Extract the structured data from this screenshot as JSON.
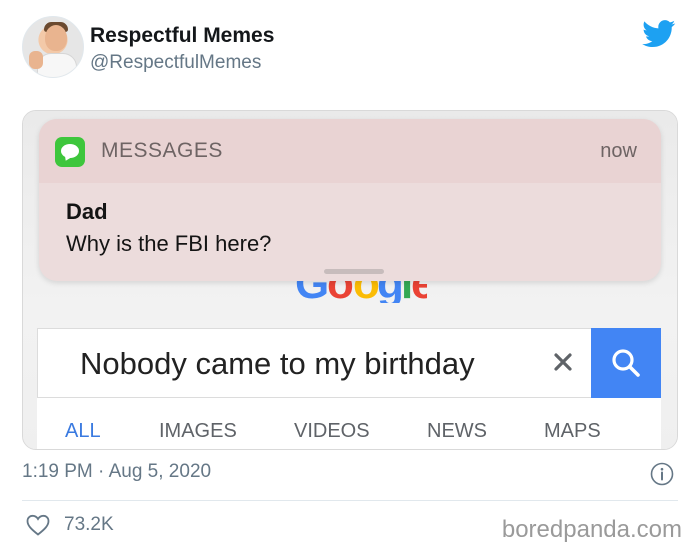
{
  "tweet": {
    "display_name": "Respectful Memes",
    "handle": "@RespectfulMemes",
    "timestamp": "1:19 PM · Aug 5, 2020",
    "likes": "73.2K"
  },
  "notification": {
    "app_name": "MESSAGES",
    "time": "now",
    "sender": "Dad",
    "message": "Why is the FBI here?"
  },
  "search": {
    "query": "Nobody came to my birthday",
    "tabs": [
      {
        "label": "ALL",
        "active": true
      },
      {
        "label": "IMAGES",
        "active": false
      },
      {
        "label": "VIDEOS",
        "active": false
      },
      {
        "label": "NEWS",
        "active": false
      },
      {
        "label": "MAPS",
        "active": false
      }
    ]
  },
  "watermark": "boredpanda.com",
  "icons": {
    "twitter": "twitter-bird-icon",
    "messages": "messages-icon",
    "clear": "close-icon",
    "search": "search-icon",
    "info": "info-icon",
    "like": "heart-icon"
  },
  "colors": {
    "twitter_blue": "#1da1f2",
    "google_blue": "#4285f4",
    "messages_green": "#3ec63c",
    "notification_bg": "#ecdcdc",
    "secondary_text": "#657786"
  }
}
